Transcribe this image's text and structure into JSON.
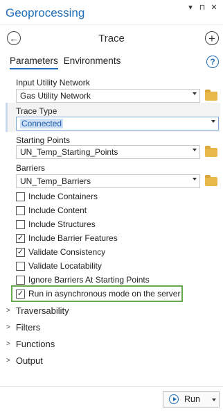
{
  "app_title": "Geoprocessing",
  "title_controls": [
    "▾",
    "⊓",
    "✕"
  ],
  "tool_title": "Trace",
  "tabs": [
    {
      "label": "Parameters",
      "active": true
    },
    {
      "label": "Environments",
      "active": false
    }
  ],
  "help_symbol": "?",
  "params": {
    "input_utility_network": {
      "label": "Input Utility Network",
      "value": "Gas Utility Network"
    },
    "trace_type": {
      "label": "Trace Type",
      "value": "Connected"
    },
    "starting_points": {
      "label": "Starting Points",
      "value": "UN_Temp_Starting_Points"
    },
    "barriers": {
      "label": "Barriers",
      "value": "UN_Temp_Barriers"
    }
  },
  "options": [
    {
      "label": "Include Containers",
      "checked": false
    },
    {
      "label": "Include Content",
      "checked": false
    },
    {
      "label": "Include Structures",
      "checked": false
    },
    {
      "label": "Include Barrier Features",
      "checked": true
    },
    {
      "label": "Validate Consistency",
      "checked": true
    },
    {
      "label": "Validate Locatability",
      "checked": false
    },
    {
      "label": "Ignore Barriers At Starting Points",
      "checked": false
    },
    {
      "label": "Run in asynchronous mode on the server",
      "checked": true
    }
  ],
  "sections": [
    "Traversability",
    "Filters",
    "Functions",
    "Output"
  ],
  "run_label": "Run",
  "colors": {
    "accent": "#1e6fb8",
    "highlight_border": "#6aa84f"
  },
  "icons": {
    "back": "back-arrow-icon",
    "add": "add-icon",
    "help": "help-icon",
    "folder": "folder-icon",
    "run": "run-play-icon"
  }
}
